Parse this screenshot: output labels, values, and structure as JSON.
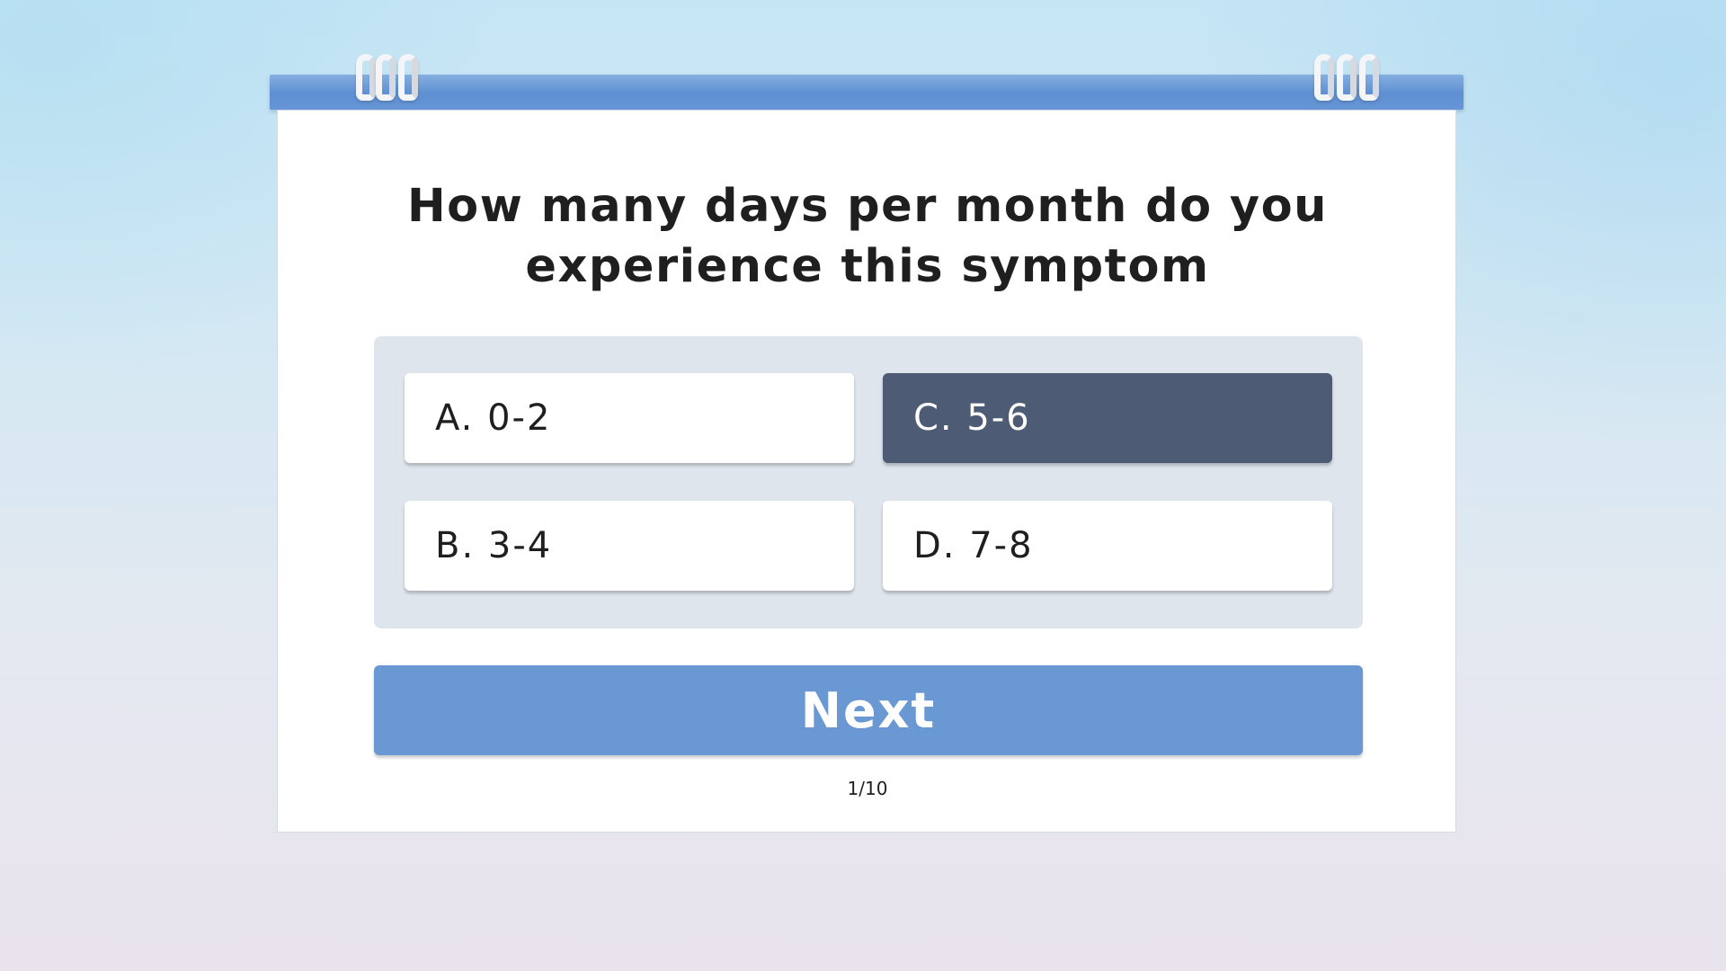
{
  "question": {
    "text": "How many days per month do you experience this symptom"
  },
  "options": [
    {
      "id": "a",
      "label": "A. 0-2",
      "selected": false
    },
    {
      "id": "b",
      "label": "B. 3-4",
      "selected": false
    },
    {
      "id": "c",
      "label": "C. 5-6",
      "selected": true
    },
    {
      "id": "d",
      "label": "D. 7-8",
      "selected": false
    }
  ],
  "next_button": {
    "label": "Next"
  },
  "progress": {
    "text": "1/10"
  },
  "colors": {
    "binder": "#5d8fd2",
    "selected_option": "#4d5c74",
    "next_button": "#6a98d2",
    "options_panel": "#dfe5ec"
  }
}
